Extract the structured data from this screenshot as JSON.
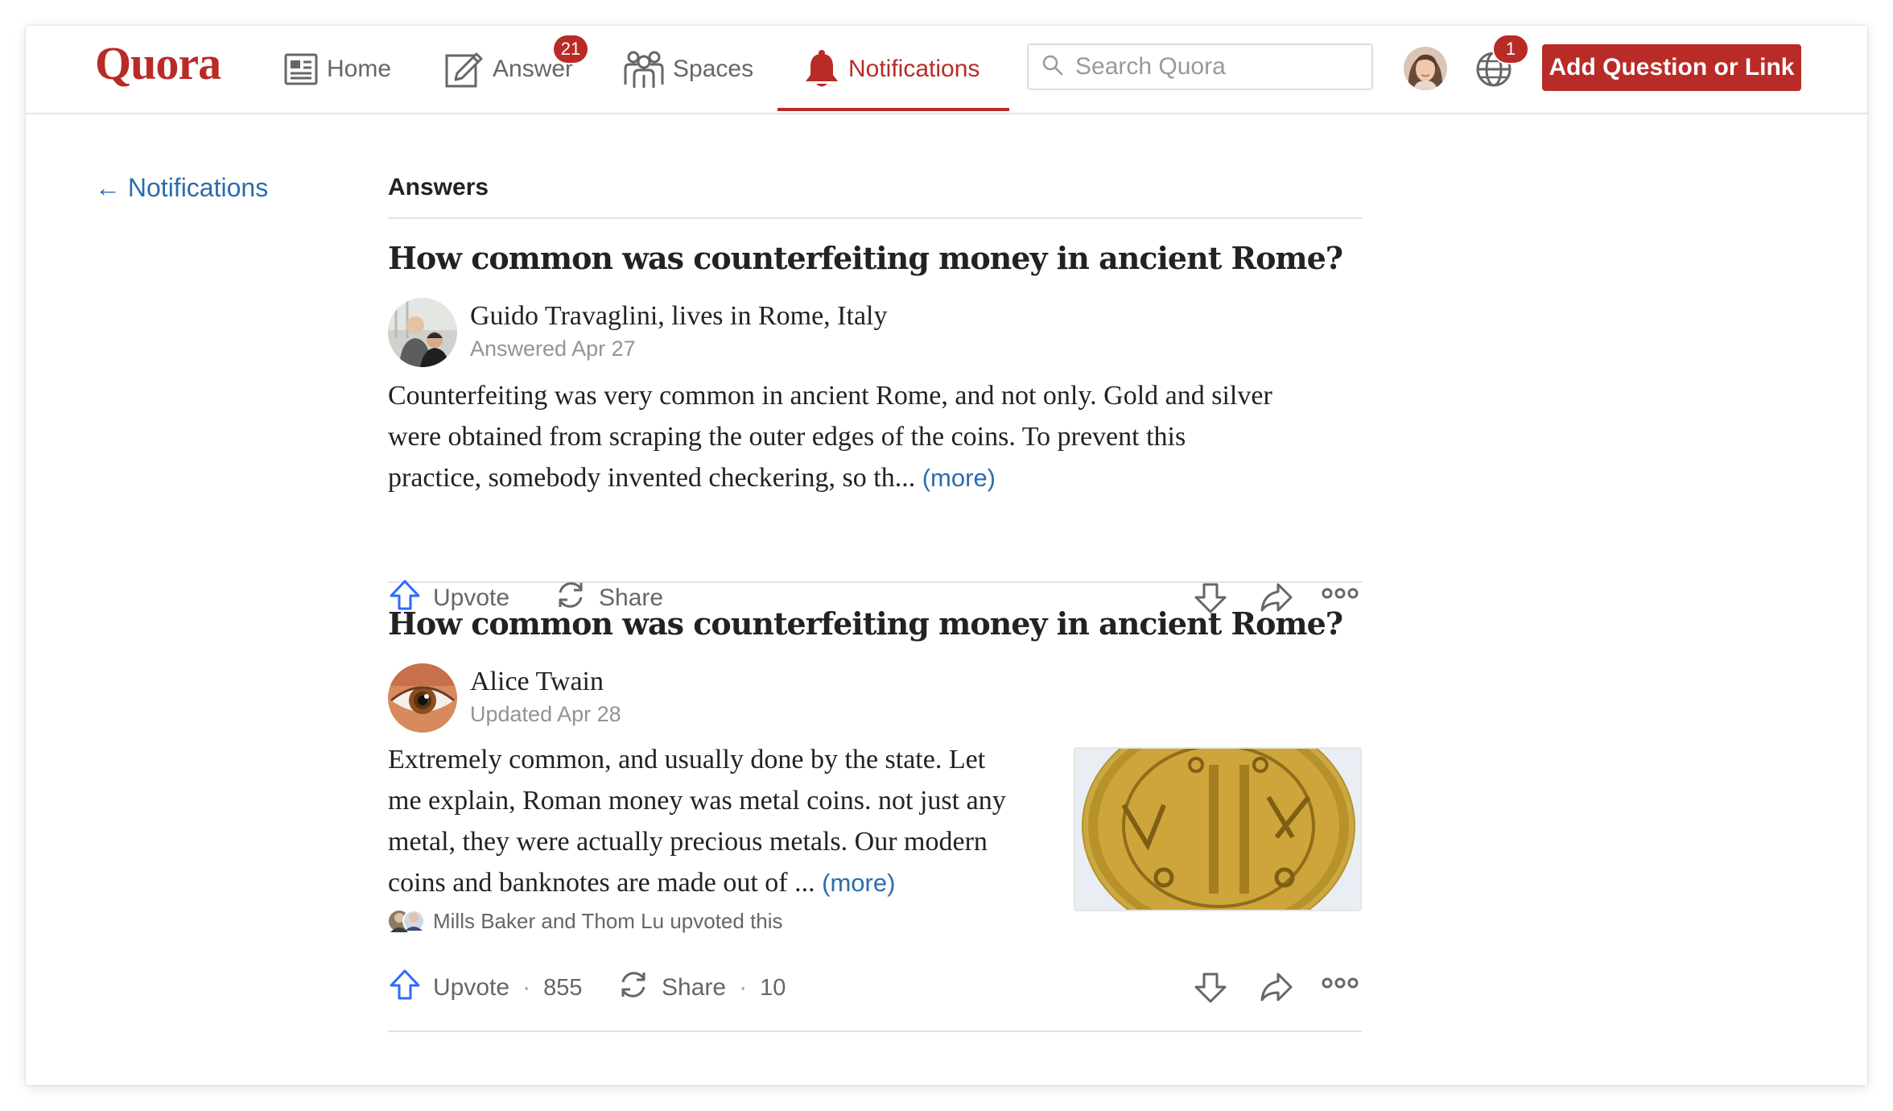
{
  "header": {
    "logo": "Quora",
    "nav": [
      {
        "label": "Home",
        "icon": "home-feed-icon"
      },
      {
        "label": "Answer",
        "icon": "answer-pencil-icon",
        "badge": "21"
      },
      {
        "label": "Spaces",
        "icon": "spaces-people-icon"
      },
      {
        "label": "Notifications",
        "icon": "bell-icon",
        "active": true
      }
    ],
    "search_placeholder": "Search Quora",
    "language_badge": "1",
    "add_button": "Add Question or Link"
  },
  "sidebar": {
    "back_link": "← Notifications"
  },
  "feed": {
    "section_title": "Answers",
    "cards": [
      {
        "question": "How common was counterfeiting money in ancient Rome?",
        "author": "Guido Travaglini, lives in Rome, Italy",
        "meta": "Answered Apr 27",
        "lines": [
          "Counterfeiting was very common in ancient Rome, and not only. Gold and silver",
          "were obtained from scraping the outer edges of the coins. To prevent this",
          "practice, somebody invented checkering, so th..."
        ],
        "more": "(more)",
        "upvote": "Upvote",
        "share": "Share"
      },
      {
        "question": "How common was counterfeiting money in ancient Rome?",
        "author": "Alice Twain",
        "meta": "Updated Apr 28",
        "lines": [
          "Extremely common, and usually done by the state. Let",
          "me explain, Roman money was metal coins. not just any",
          "metal, they were actually precious metals. Our modern",
          "coins and banknotes are made out of ..."
        ],
        "more": "(more)",
        "upvoted_by": "Mills Baker and Thom Lu upvoted this",
        "upvote": "Upvote",
        "upvote_count": "855",
        "share": "Share",
        "share_count": "10"
      }
    ]
  },
  "colors": {
    "brand": "#b92b27",
    "link": "#2b6dad",
    "upvote": "#2e69ff"
  }
}
